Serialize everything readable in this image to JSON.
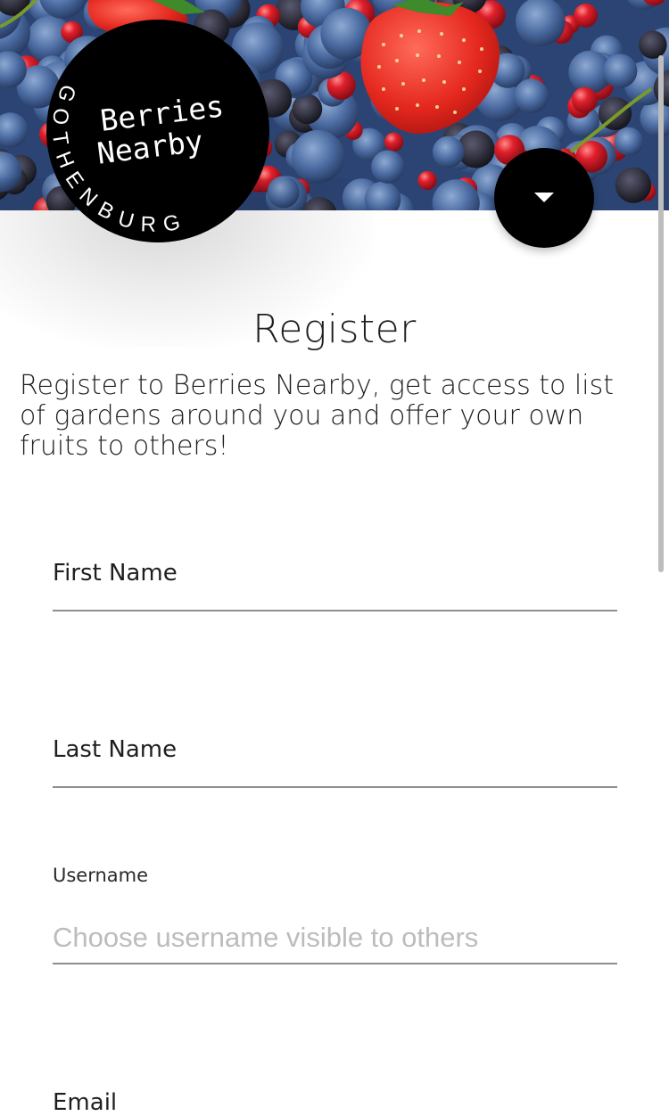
{
  "header": {
    "logo": {
      "title_line1": "Berries",
      "title_line2": "Nearby",
      "city": "GOTHENBURG"
    },
    "menu_button_icon": "caret-down-icon"
  },
  "main": {
    "title": "Register",
    "intro": "Register to Berries Nearby, get access to list of gardens around you and offer your own fruits to others!"
  },
  "form": {
    "first_name": {
      "label": "First Name",
      "value": ""
    },
    "last_name": {
      "label": "Last Name",
      "value": ""
    },
    "username": {
      "label": "Username",
      "placeholder": "Choose username visible to others",
      "value": ""
    },
    "email": {
      "label": "Email",
      "value": ""
    }
  },
  "colors": {
    "accent": "#000000",
    "blueberry": "#3b5a8c",
    "currant": "#d0202a",
    "strawberry": "#e8332e",
    "underline": "#8e8e8e",
    "placeholder": "#bcbcbc"
  }
}
